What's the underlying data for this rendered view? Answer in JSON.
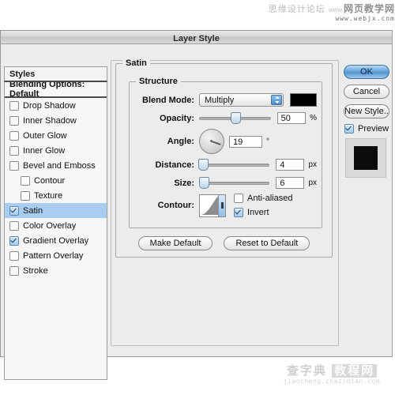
{
  "watermarks": {
    "top_line1_cn": "思缘设计论坛",
    "top_line1_www": "www.",
    "top_line1_cn2": "网页教学网",
    "top_line2": "www.webjx.com",
    "bottom_cn1": "查字典",
    "bottom_cn2": "教程网",
    "bottom_url": "jiaocheng.chazidian.com"
  },
  "window": {
    "title": "Layer Style"
  },
  "sidebar": {
    "header": "Styles",
    "blending_options": "Blending Options: Default",
    "items": [
      {
        "label": "Drop Shadow",
        "checked": false,
        "indent": false,
        "selected": false
      },
      {
        "label": "Inner Shadow",
        "checked": false,
        "indent": false,
        "selected": false
      },
      {
        "label": "Outer Glow",
        "checked": false,
        "indent": false,
        "selected": false
      },
      {
        "label": "Inner Glow",
        "checked": false,
        "indent": false,
        "selected": false
      },
      {
        "label": "Bevel and Emboss",
        "checked": false,
        "indent": false,
        "selected": false
      },
      {
        "label": "Contour",
        "checked": false,
        "indent": true,
        "selected": false
      },
      {
        "label": "Texture",
        "checked": false,
        "indent": true,
        "selected": false
      },
      {
        "label": "Satin",
        "checked": true,
        "indent": false,
        "selected": true
      },
      {
        "label": "Color Overlay",
        "checked": false,
        "indent": false,
        "selected": false
      },
      {
        "label": "Gradient Overlay",
        "checked": true,
        "indent": false,
        "selected": false
      },
      {
        "label": "Pattern Overlay",
        "checked": false,
        "indent": false,
        "selected": false
      },
      {
        "label": "Stroke",
        "checked": false,
        "indent": false,
        "selected": false
      }
    ]
  },
  "main": {
    "group_title": "Satin",
    "structure_title": "Structure",
    "blend_mode": {
      "label": "Blend Mode:",
      "value": "Multiply",
      "color": "#000000"
    },
    "opacity": {
      "label": "Opacity:",
      "value": "50",
      "unit": "%",
      "percent": 50
    },
    "angle": {
      "label": "Angle:",
      "value": "19",
      "unit": "°",
      "degrees": 19
    },
    "distance": {
      "label": "Distance:",
      "value": "4",
      "unit": "px",
      "percent": 4
    },
    "size": {
      "label": "Size:",
      "value": "6",
      "unit": "px",
      "percent": 6
    },
    "contour": {
      "label": "Contour:"
    },
    "anti_aliased": {
      "label": "Anti-aliased",
      "checked": false
    },
    "invert": {
      "label": "Invert",
      "checked": true
    },
    "make_default": "Make Default",
    "reset_to_default": "Reset to Default"
  },
  "actions": {
    "ok": "OK",
    "cancel": "Cancel",
    "new_style": "New Style..",
    "preview": {
      "label": "Preview",
      "checked": true
    }
  },
  "colors": {
    "accent": "#4e8dc9",
    "selection": "#a9cdf0",
    "swatch": "#000000"
  }
}
